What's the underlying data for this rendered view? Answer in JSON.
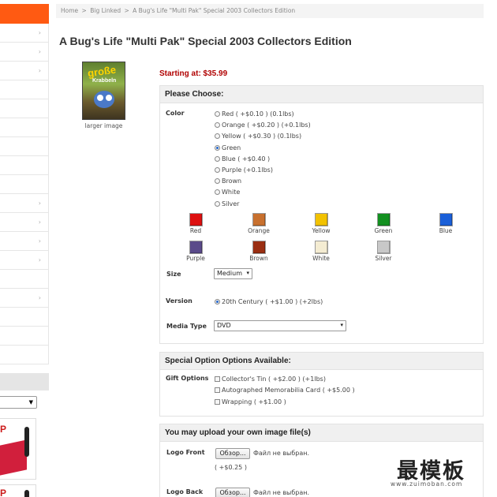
{
  "breadcrumb": {
    "items": [
      "Home",
      "Big Linked",
      "A Bug's Life \"Multi Pak\" Special 2003 Collectors Edition"
    ],
    "separator": ">"
  },
  "product": {
    "title": "A Bug's Life \"Multi Pak\" Special 2003 Collectors Edition",
    "price": "Starting at: $35.99",
    "image_link": "larger image",
    "cover_text": [
      "große",
      "Krabbeln"
    ]
  },
  "choose_panel": {
    "heading": "Please Choose:",
    "color": {
      "label": "Color",
      "options": [
        {
          "label": "Red ( +$0.10 ) (0.1lbs)",
          "selected": false
        },
        {
          "label": "Orange ( +$0.20 ) (+0.1lbs)",
          "selected": false
        },
        {
          "label": "Yellow ( +$0.30 ) (0.1lbs)",
          "selected": false
        },
        {
          "label": "Green",
          "selected": true
        },
        {
          "label": "Blue ( +$0.40 )",
          "selected": false
        },
        {
          "label": "Purple (+0.1lbs)",
          "selected": false
        },
        {
          "label": "Brown",
          "selected": false
        },
        {
          "label": "White",
          "selected": false
        },
        {
          "label": "Silver",
          "selected": false
        }
      ],
      "swatches": [
        {
          "label": "Red",
          "color": "#dd1010"
        },
        {
          "label": "Orange",
          "color": "#c8702e"
        },
        {
          "label": "Yellow",
          "color": "#f2c200"
        },
        {
          "label": "Green",
          "color": "#139020"
        },
        {
          "label": "Blue",
          "color": "#1a5fd8"
        },
        {
          "label": "Purple",
          "color": "#5a4a8a"
        },
        {
          "label": "Brown",
          "color": "#9a2e12"
        },
        {
          "label": "White",
          "color": "#f4ecd2"
        },
        {
          "label": "Silver",
          "color": "#c8c8c8"
        }
      ]
    },
    "size": {
      "label": "Size",
      "value": "Medium"
    },
    "version": {
      "label": "Version",
      "option": "20th Century ( +$1.00 ) (+2lbs)",
      "selected": true
    },
    "media_type": {
      "label": "Media Type",
      "value": "DVD"
    }
  },
  "special_panel": {
    "heading": "Special Option Options Available:",
    "gift_label": "Gift Options",
    "gift_options": [
      {
        "label": "Collector's Tin ( +$2.00 ) (+1lbs)",
        "checked": false
      },
      {
        "label": "Autographed Memorabilia Card ( +$5.00 )",
        "checked": false
      },
      {
        "label": "Wrapping ( +$1.00 )",
        "checked": false
      }
    ]
  },
  "upload_panel": {
    "heading": "You may upload your own image file(s)",
    "logo_front": {
      "label": "Logo Front",
      "button": "Обзор...",
      "status": "Файл не выбран.",
      "price": "( +$0.25 )"
    },
    "logo_back": {
      "label": "Logo Back",
      "button": "Обзор...",
      "status": "Файл не выбран."
    }
  },
  "watermark": {
    "brand": "最模板",
    "url": "www.zuimoban.com"
  }
}
